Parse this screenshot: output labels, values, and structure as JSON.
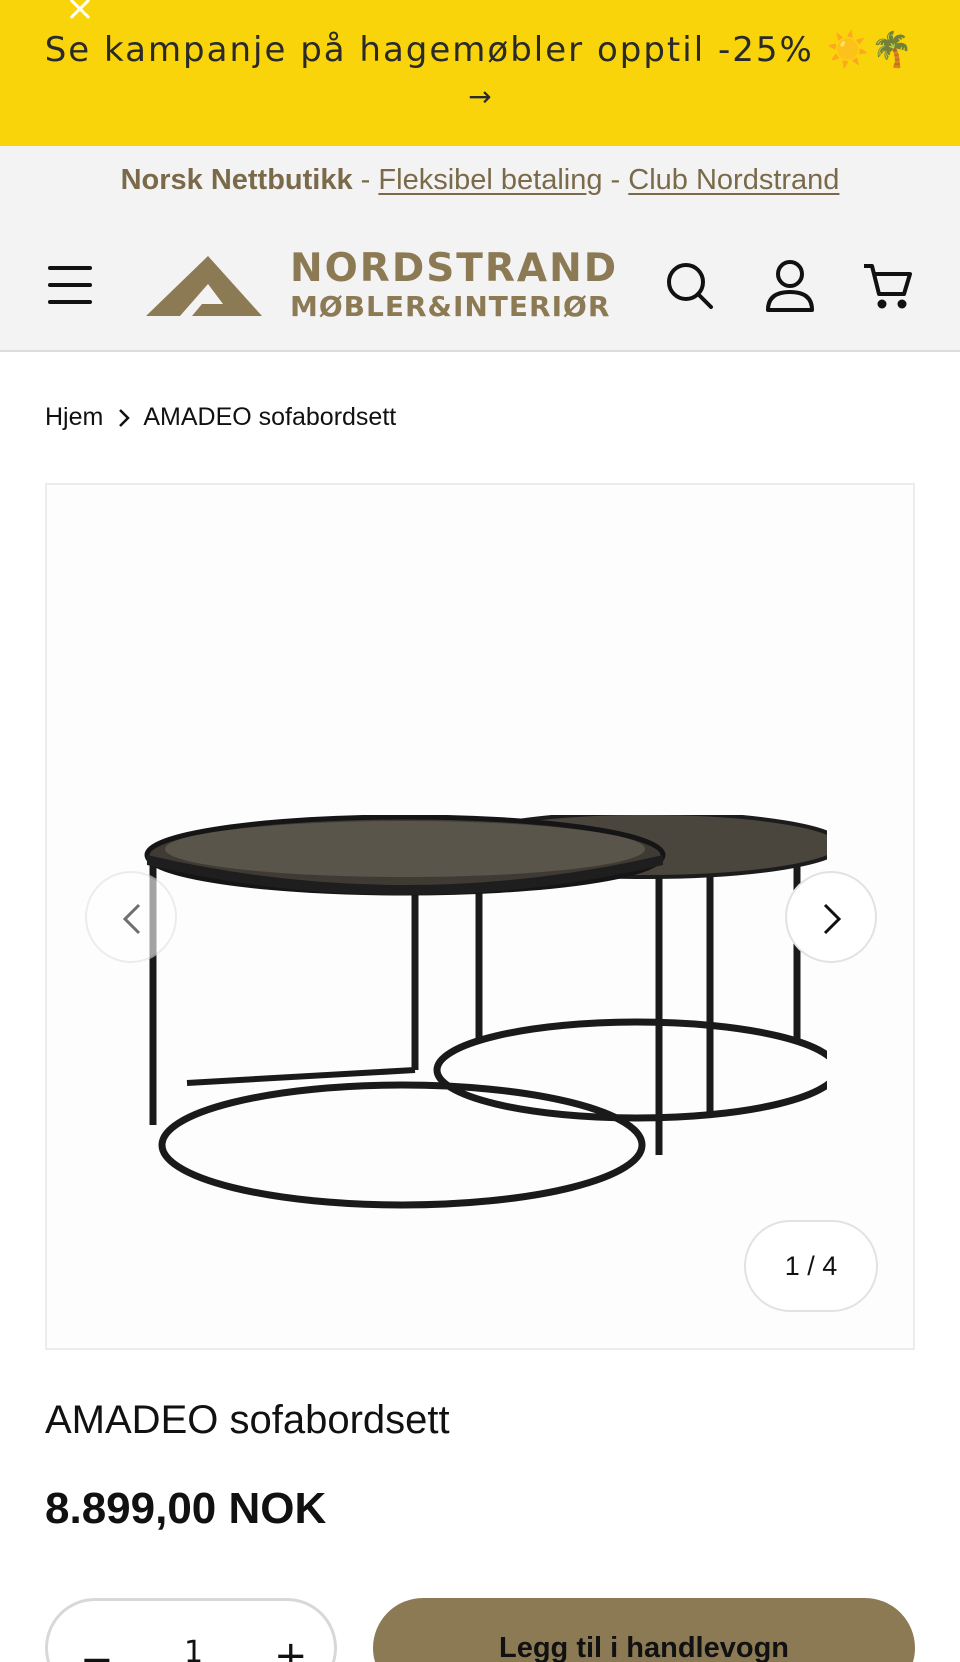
{
  "promo": {
    "close_glyph": "×",
    "text": "Se kampanje på hagemøbler opptil -25% ☀️🌴",
    "arrow": "→"
  },
  "info_strip": {
    "brand_text": "Norsk Nettbutikk",
    "separator": "-",
    "link1": "Fleksibel betaling",
    "link2": "Club Nordstrand"
  },
  "header": {
    "menu_icon": "hamburger-menu-icon",
    "logo_line1": "NORDSTRAND",
    "logo_line2": "MØBLER&INTERIØR",
    "search_icon": "search-icon",
    "account_icon": "user-icon",
    "cart_icon": "cart-icon"
  },
  "breadcrumb": {
    "home": "Hjem",
    "current": "AMADEO sofabordsett"
  },
  "gallery": {
    "counter": "1 / 4",
    "current_index": 1,
    "total": 4
  },
  "product": {
    "title": "AMADEO sofabordsett",
    "price": "8.899,00 NOK"
  },
  "buy": {
    "quantity": "1",
    "minus": "−",
    "plus": "+",
    "add_to_cart_label": "Legg til i handlevogn"
  },
  "colors": {
    "promo_bg": "#f9d40a",
    "brand_gold": "#8c7a55",
    "header_bg": "#f3f3f3"
  }
}
